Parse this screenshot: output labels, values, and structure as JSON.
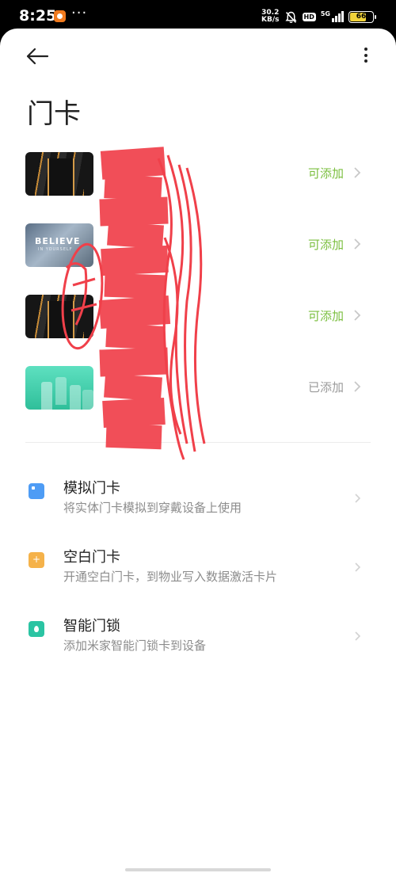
{
  "status_bar": {
    "time": "8:25",
    "notification_dots": "···",
    "net_speed_value": "30.2",
    "net_speed_unit": "KB/s",
    "hd_badge": "HD",
    "network_type": "5G",
    "battery_level": "66"
  },
  "header": {
    "title": "门卡",
    "back_icon": "arrow-left-icon",
    "more_icon": "more-vertical-icon"
  },
  "cards": [
    {
      "thumbnail": "dark-gold-stripes",
      "status": "可添加",
      "status_color": "#7bbf3f"
    },
    {
      "thumbnail": "believe-poster",
      "thumbnail_text": "BELIEVE",
      "thumbnail_subtext": "IN YOURSELF",
      "status": "可添加",
      "status_color": "#7bbf3f"
    },
    {
      "thumbnail": "dark-gold-stripes",
      "status": "可添加",
      "status_color": "#7bbf3f"
    },
    {
      "thumbnail": "green-buildings",
      "status": "已添加",
      "status_color": "#9a9a9a"
    }
  ],
  "options": [
    {
      "icon": "card-blue-icon",
      "color": "#4e9cf5",
      "title": "模拟门卡",
      "subtitle": "将实体门卡模拟到穿戴设备上使用"
    },
    {
      "icon": "card-plus-icon",
      "color": "#f5b24a",
      "title": "空白门卡",
      "subtitle": "开通空白门卡，到物业写入数据激活卡片"
    },
    {
      "icon": "lock-drop-icon",
      "color": "#2bc4a3",
      "title": "智能门锁",
      "subtitle": "添加米家智能门锁卡到设备"
    }
  ],
  "redaction_color": "#f0404a"
}
